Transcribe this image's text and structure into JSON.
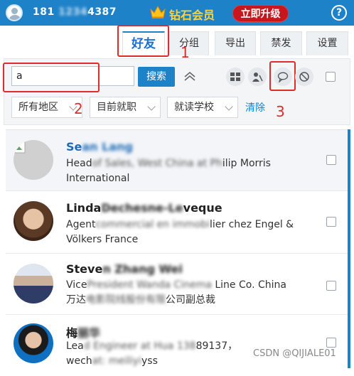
{
  "topbar": {
    "phone_prefix": "181",
    "phone_hidden": "1234",
    "phone_suffix": "4387",
    "vip_label": "钻石会员",
    "upgrade_label": "立即升级",
    "help_label": "?"
  },
  "tabs": [
    "好友",
    "分组",
    "导出",
    "禁发",
    "设置"
  ],
  "search": {
    "value": "a",
    "button_label": "搜索"
  },
  "filters": [
    "所有地区",
    "目前就职",
    "就读学校"
  ],
  "clear_label": "清除",
  "annotations": [
    "1",
    "2",
    "3"
  ],
  "contacts": [
    {
      "name_visible": "Se",
      "name_blurred": "an Lang",
      "line1_visible": "Head",
      "line1_blurred": " of Sales, West China at Ph",
      "line1_tail": "ilip Morris",
      "line2": "International"
    },
    {
      "name_visible": "Linda",
      "name_blurred": " Dechesne-Le",
      "name_tail": "veque",
      "line1_visible": "Agent",
      "line1_blurred": " commercial en immobi",
      "line1_tail": "lier chez Engel &",
      "line2": "Völkers France"
    },
    {
      "name_visible": "Steve",
      "name_blurred": "n Zhang Wei",
      "line1_visible": "Vice",
      "line1_blurred": " President Wanda Cinema",
      "line1_tail": " Line Co. China",
      "line2_visible": "万达",
      "line2_blurred": "电影院线股份有限",
      "line2_tail": "公司副总裁"
    },
    {
      "name_visible": "梅",
      "name_blurred": "丽华",
      "line1_visible": "Lea",
      "line1_blurred": "d Engineer at Hua 138",
      "line1_tail": "89137，",
      "line2_visible": "wech",
      "line2_blurred": "at: meiliyi",
      "line2_tail": "yss"
    }
  ],
  "watermark": "CSDN @QIJIALE01"
}
